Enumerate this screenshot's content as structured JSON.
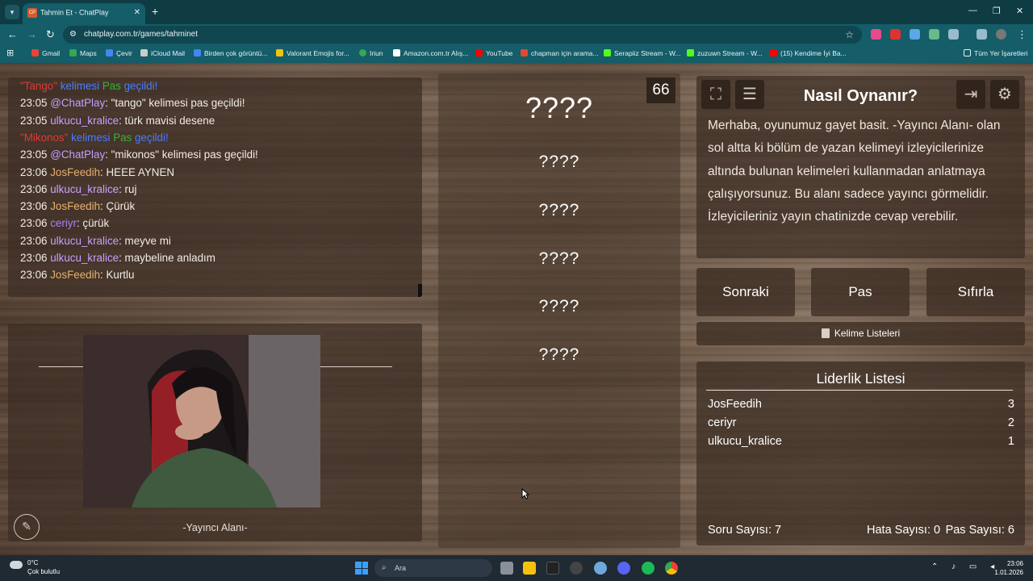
{
  "browser": {
    "tab_title": "Tahmin Et - ChatPlay",
    "tab_favicon": "CP",
    "url": "chatplay.com.tr/games/tahminet",
    "bookmarks": [
      {
        "label": "Gmail",
        "color": "#ea4335"
      },
      {
        "label": "Maps",
        "color": "#34a853"
      },
      {
        "label": "Çevir",
        "color": "#4285f4"
      },
      {
        "label": "iCloud Mail",
        "color": "#cccccc"
      },
      {
        "label": "Birden çok görüntü...",
        "color": "#4285f4"
      },
      {
        "label": "Valorant Emojis for...",
        "color": "#f4c20d"
      },
      {
        "label": "Iriun",
        "color": "#34a853"
      },
      {
        "label": "Amazon.com.tr Alış...",
        "color": "#ffffff"
      },
      {
        "label": "YouTube",
        "color": "#ff0000"
      },
      {
        "label": "chapman için arama...",
        "color": "#e04b2e"
      },
      {
        "label": "Serapiiz Stream - W...",
        "color": "#53fc18"
      },
      {
        "label": "zuzuwn Stream - W...",
        "color": "#53fc18"
      },
      {
        "label": "(15) Kendime İyi Ba...",
        "color": "#ff0000"
      }
    ],
    "all_bookmarks": "Tüm Yer İşaretleri"
  },
  "chat": {
    "lines": [
      {
        "time": "",
        "parts": [
          [
            "sys-red",
            "\"Tango\" "
          ],
          [
            "sys-blue",
            "kelimesi "
          ],
          [
            "sys-green",
            "Pas "
          ],
          [
            "sys-blue",
            "geçildi!"
          ]
        ]
      },
      {
        "time": "23:05",
        "user": "@ChatPlay",
        "ucls": "u-chatplay",
        "msg": "\"tango\" kelimesi pas geçildi!"
      },
      {
        "time": "23:05",
        "user": "ulkucu_kralice",
        "ucls": "u-ulkucu",
        "msg": "türk mavisi desene"
      },
      {
        "time": "",
        "parts": [
          [
            "sys-red",
            "\"Mikonos\" "
          ],
          [
            "sys-blue",
            "kelimesi "
          ],
          [
            "sys-green",
            "Pas "
          ],
          [
            "sys-blue",
            "geçildi!"
          ]
        ]
      },
      {
        "time": "23:05",
        "user": "@ChatPlay",
        "ucls": "u-chatplay",
        "msg": "\"mikonos\" kelimesi pas geçildi!"
      },
      {
        "time": "23:06",
        "user": "JosFeedih",
        "ucls": "u-jos",
        "msg": "HEEE AYNEN"
      },
      {
        "time": "23:06",
        "user": "ulkucu_kralice",
        "ucls": "u-ulkucu",
        "msg": "ruj"
      },
      {
        "time": "23:06",
        "user": "JosFeedih",
        "ucls": "u-jos",
        "msg": "Çürük"
      },
      {
        "time": "23:06",
        "user": "ceriyr",
        "ucls": "u-ceriyr",
        "msg": "çürük"
      },
      {
        "time": "23:06",
        "user": "ulkucu_kralice",
        "ucls": "u-ulkucu",
        "msg": "meyve mi"
      },
      {
        "time": "23:06",
        "user": "ulkucu_kralice",
        "ucls": "u-ulkucu",
        "msg": "maybeline anladım"
      },
      {
        "time": "23:06",
        "user": "JosFeedih",
        "ucls": "u-jos",
        "msg": "Kurtlu"
      }
    ]
  },
  "streamer": {
    "label": "-Yayıncı Alanı-"
  },
  "game": {
    "timer": "66",
    "words": [
      "????",
      "????",
      "????",
      "????",
      "????",
      "????"
    ]
  },
  "howto": {
    "title": "Nasıl Oynanır?",
    "body": "Merhaba, oyunumuz gayet basit. -Yayıncı Alanı- olan sol altta ki bölüm de yazan kelimeyi izleyicilerinize altında bulunan kelimeleri kullanmadan anlatmaya çalışıyorsunuz. Bu alanı sadece yayıncı görmelidir. İzleyicileriniz yayın chatinizde cevap verebilir."
  },
  "controls": {
    "next": "Sonraki",
    "pass": "Pas",
    "reset": "Sıfırla",
    "word_lists": "Kelime Listeleri"
  },
  "leaderboard": {
    "title": "Liderlik Listesi",
    "rows": [
      {
        "name": "JosFeedih",
        "score": "3"
      },
      {
        "name": "ceriyr",
        "score": "2"
      },
      {
        "name": "ulkucu_kralice",
        "score": "1"
      }
    ],
    "questions": "Soru Sayısı: 7",
    "errors": "Hata Sayısı: 0",
    "passes": "Pas Sayısı: 6"
  },
  "taskbar": {
    "temp": "0°C",
    "weather": "Çok bulutlu",
    "search": "Ara",
    "time": "23:06",
    "date": "1.01.2026"
  }
}
